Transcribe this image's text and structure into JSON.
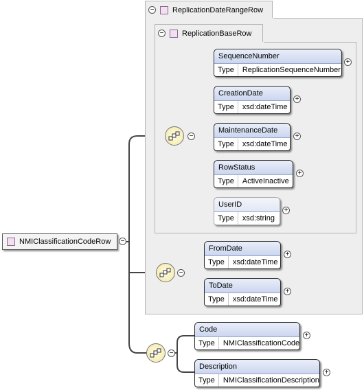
{
  "root": {
    "name": "NMIClassificationCodeRow"
  },
  "groups": {
    "outer": {
      "name": "ReplicationDateRangeRow"
    },
    "inner": {
      "name": "ReplicationBaseRow"
    }
  },
  "type_label": "Type",
  "elements": {
    "sequence_number": {
      "name": "SequenceNumber",
      "type": "ReplicationSequenceNumber"
    },
    "creation_date": {
      "name": "CreationDate",
      "type": "xsd:dateTime"
    },
    "maintenance_date": {
      "name": "MaintenanceDate",
      "type": "xsd:dateTime"
    },
    "row_status": {
      "name": "RowStatus",
      "type": "ActiveInactive"
    },
    "user_id": {
      "name": "UserID",
      "type": "xsd:string"
    },
    "from_date": {
      "name": "FromDate",
      "type": "xsd:dateTime"
    },
    "to_date": {
      "name": "ToDate",
      "type": "xsd:dateTime"
    },
    "code": {
      "name": "Code",
      "type": "NMIClassificationCode"
    },
    "description": {
      "name": "Description",
      "type": "NMIClassificationDescription"
    }
  },
  "symbols": {
    "expand": "+",
    "collapse": "−"
  },
  "colors": {
    "group_bg": "#eeeeee",
    "element_header": "#cbd6ef",
    "sequence_bg": "#f2e6a8",
    "connector": "#444444"
  }
}
